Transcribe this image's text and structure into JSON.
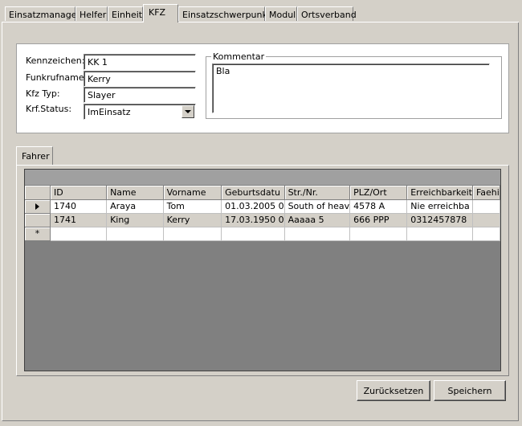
{
  "tabs": [
    {
      "label": "Einsatzmanager"
    },
    {
      "label": "Helfer"
    },
    {
      "label": "Einheit"
    },
    {
      "label": "KFZ"
    },
    {
      "label": "Einsatzschwerpunkt"
    },
    {
      "label": "Modul"
    },
    {
      "label": "Ortsverband"
    }
  ],
  "active_tab": "KFZ",
  "form": {
    "kennzeichen_label": "Kennzeichen:",
    "kennzeichen_value": "KK 1",
    "funkrufname_label": "Funkrufname:",
    "funkrufname_value": "Kerry",
    "kfztyp_label": "Kfz Typ:",
    "kfztyp_value": "Slayer",
    "status_label": "Krf.Status:",
    "status_value": "ImEinsatz",
    "kommentar_label": "Kommentar",
    "kommentar_value": "Bla"
  },
  "inner_tab": {
    "label": "Fahrer"
  },
  "grid": {
    "columns": [
      "ID",
      "Name",
      "Vorname",
      "Geburtsdatu",
      "Str./Nr.",
      "PLZ/Ort",
      "Erreichbarkeit",
      "Faehi"
    ],
    "rows": [
      [
        "1740",
        "Araya",
        "Tom",
        "01.03.2005 0",
        "South of heav",
        "4578 A",
        "Nie erreichba",
        ""
      ],
      [
        "1741",
        "King",
        "Kerry",
        "17.03.1950 0",
        "Aaaaa 5",
        "666 PPP",
        "0312457878",
        ""
      ]
    ],
    "new_row_marker": "*"
  },
  "buttons": {
    "reset_label": "Zurücksetzen",
    "save_label": "Speichern"
  },
  "colors": {
    "window_bg": "#d4d0c8",
    "grid_bg": "#808080",
    "caption_bar": "#a0a0a0"
  }
}
